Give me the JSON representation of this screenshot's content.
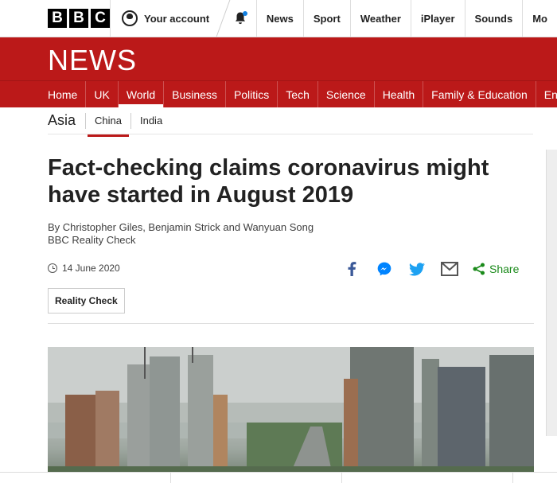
{
  "topbar": {
    "logo_letters": [
      "B",
      "B",
      "C"
    ],
    "account_label": "Your account",
    "nav": [
      "News",
      "Sport",
      "Weather",
      "iPlayer",
      "Sounds",
      "Mo"
    ]
  },
  "news_header": {
    "title": "NEWS"
  },
  "news_nav": {
    "items": [
      "Home",
      "UK",
      "World",
      "Business",
      "Politics",
      "Tech",
      "Science",
      "Health",
      "Family & Education",
      "En"
    ],
    "active": "World"
  },
  "subnav": {
    "section": "Asia",
    "items": [
      "China",
      "India"
    ],
    "active": "China"
  },
  "article": {
    "headline": "Fact-checking claims coronavirus might have started in August 2019",
    "byline_authors": "By Christopher Giles, Benjamin Strick and Wanyuan Song",
    "byline_unit": "BBC Reality Check",
    "date": "14 June 2020",
    "share_label": "Share",
    "tag_label": "Reality Check"
  },
  "colors": {
    "brand_red": "#bb1919",
    "share_green": "#1a8a1a",
    "facebook_blue": "#3b5998",
    "twitter_blue": "#1da1f2",
    "messenger_blue": "#0084ff"
  }
}
